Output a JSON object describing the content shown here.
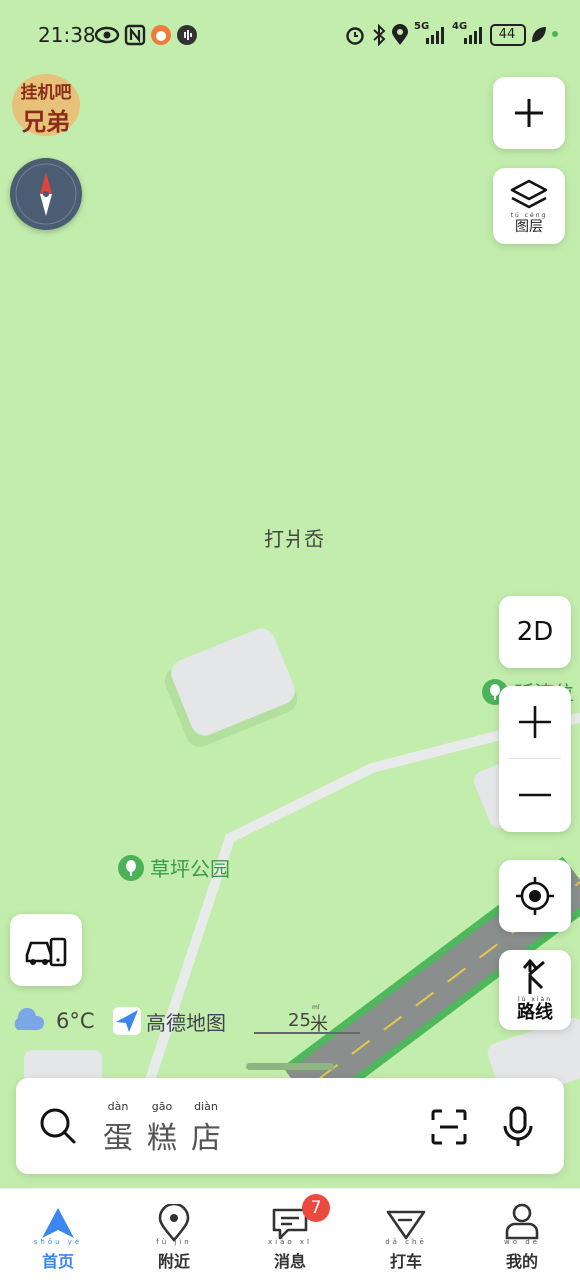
{
  "status_bar": {
    "time": "21:38",
    "battery": "44",
    "network_1": "5G",
    "network_2": "4G",
    "icons": [
      "eye-icon",
      "nfc-icon",
      "app-icon",
      "audio-icon",
      "alarm-icon",
      "bluetooth-icon",
      "location-icon",
      "signal-icon",
      "battery-icon",
      "leaf-icon"
    ]
  },
  "map": {
    "place_label_top": "打爿岙",
    "park_label": "草坪公园",
    "park_label_partial": "昕涛位",
    "weather": {
      "temp": "6°C",
      "icon": "cloud-icon"
    },
    "brand": "高德地图",
    "scale": {
      "value": "25",
      "unit_pinyin": "mǐ",
      "unit": "米"
    },
    "colors": {
      "land": "#c3edac",
      "road": "#8a8f8d",
      "road_edge": "#4db85c",
      "building": "#e4e6e8",
      "accent": "#3b86f0"
    }
  },
  "controls": {
    "add_icon": "plus-icon",
    "layers": {
      "pinyin": "tú céng",
      "label": "图层"
    },
    "view_mode": "2D",
    "zoom_in": "zoom-in-icon",
    "zoom_out": "zoom-out-icon",
    "locate": "locate-icon",
    "route": {
      "pinyin": "lù xiàn",
      "label": "路线"
    },
    "car_mode": "car-phone-icon"
  },
  "sticker": {
    "line1": "挂机吧",
    "line2": "兄弟"
  },
  "search": {
    "pinyin": [
      "dàn",
      "gāo",
      "diàn"
    ],
    "chars": [
      "蛋",
      "糕",
      "店"
    ],
    "scan_icon": "scan-icon",
    "mic_icon": "mic-icon"
  },
  "nav": {
    "items": [
      {
        "pinyin": "shǒu yè",
        "label": "首页",
        "active": true
      },
      {
        "pinyin": "fù jìn",
        "label": "附近",
        "active": false
      },
      {
        "pinyin": "xiāo xī",
        "label": "消息",
        "active": false
      },
      {
        "pinyin": "dǎ chē",
        "label": "打车",
        "active": false
      },
      {
        "pinyin": "wǒ de",
        "label": "我的",
        "active": false
      }
    ],
    "messages_badge": "7"
  }
}
